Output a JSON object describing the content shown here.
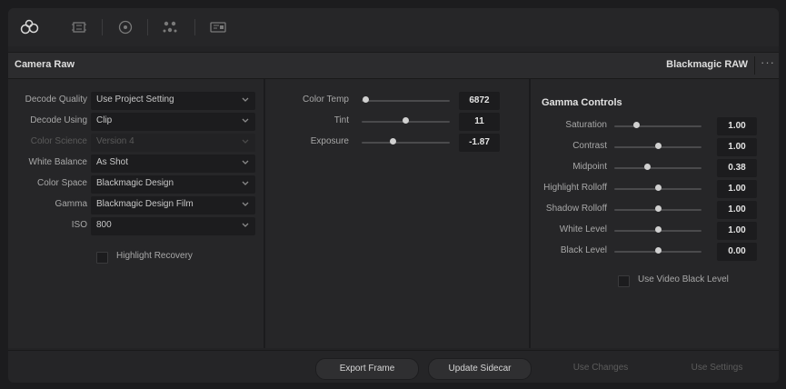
{
  "toolbar": {
    "icons": [
      {
        "name": "camera-raw-icon"
      },
      {
        "name": "frame-icon"
      },
      {
        "name": "color-target-icon"
      },
      {
        "name": "nodes-icon"
      },
      {
        "name": "sidecar-icon"
      }
    ]
  },
  "header": {
    "title": "Camera Raw",
    "format": "Blackmagic RAW",
    "more": "···"
  },
  "left": {
    "rows": [
      {
        "label": "Decode Quality",
        "value": "Use Project Setting",
        "enabled": true
      },
      {
        "label": "Decode Using",
        "value": "Clip",
        "enabled": true
      },
      {
        "label": "Color Science",
        "value": "Version 4",
        "enabled": false
      },
      {
        "label": "White Balance",
        "value": "As Shot",
        "enabled": true
      },
      {
        "label": "Color Space",
        "value": "Blackmagic Design",
        "enabled": true
      },
      {
        "label": "Gamma",
        "value": "Blackmagic Design Film",
        "enabled": true
      },
      {
        "label": "ISO",
        "value": "800",
        "enabled": true
      }
    ],
    "highlight_recovery": {
      "label": "Highlight Recovery",
      "checked": false
    }
  },
  "middle": {
    "sliders": [
      {
        "label": "Color Temp",
        "value": "6872",
        "position": 0.05
      },
      {
        "label": "Tint",
        "value": "11",
        "position": 0.5
      },
      {
        "label": "Exposure",
        "value": "-1.87",
        "position": 0.36
      }
    ]
  },
  "gamma": {
    "title": "Gamma Controls",
    "sliders": [
      {
        "label": "Saturation",
        "value": "1.00",
        "position": 0.25
      },
      {
        "label": "Contrast",
        "value": "1.00",
        "position": 0.5
      },
      {
        "label": "Midpoint",
        "value": "0.38",
        "position": 0.38
      },
      {
        "label": "Highlight Rolloff",
        "value": "1.00",
        "position": 0.5
      },
      {
        "label": "Shadow Rolloff",
        "value": "1.00",
        "position": 0.5
      },
      {
        "label": "White Level",
        "value": "1.00",
        "position": 0.5
      },
      {
        "label": "Black Level",
        "value": "0.00",
        "position": 0.5
      }
    ],
    "use_video_black_level": {
      "label": "Use Video Black Level",
      "checked": false
    }
  },
  "footer": {
    "buttons": [
      {
        "label": "Export Frame",
        "enabled": true
      },
      {
        "label": "Update Sidecar",
        "enabled": true
      },
      {
        "label": "Use Changes",
        "enabled": false
      },
      {
        "label": "Use Settings",
        "enabled": false
      }
    ]
  },
  "colors": {
    "background": "#1c1c1e",
    "panel": "#262628",
    "field": "#1c1c1e",
    "text": "#c9c9c9",
    "knob": "#d0d0d0"
  }
}
